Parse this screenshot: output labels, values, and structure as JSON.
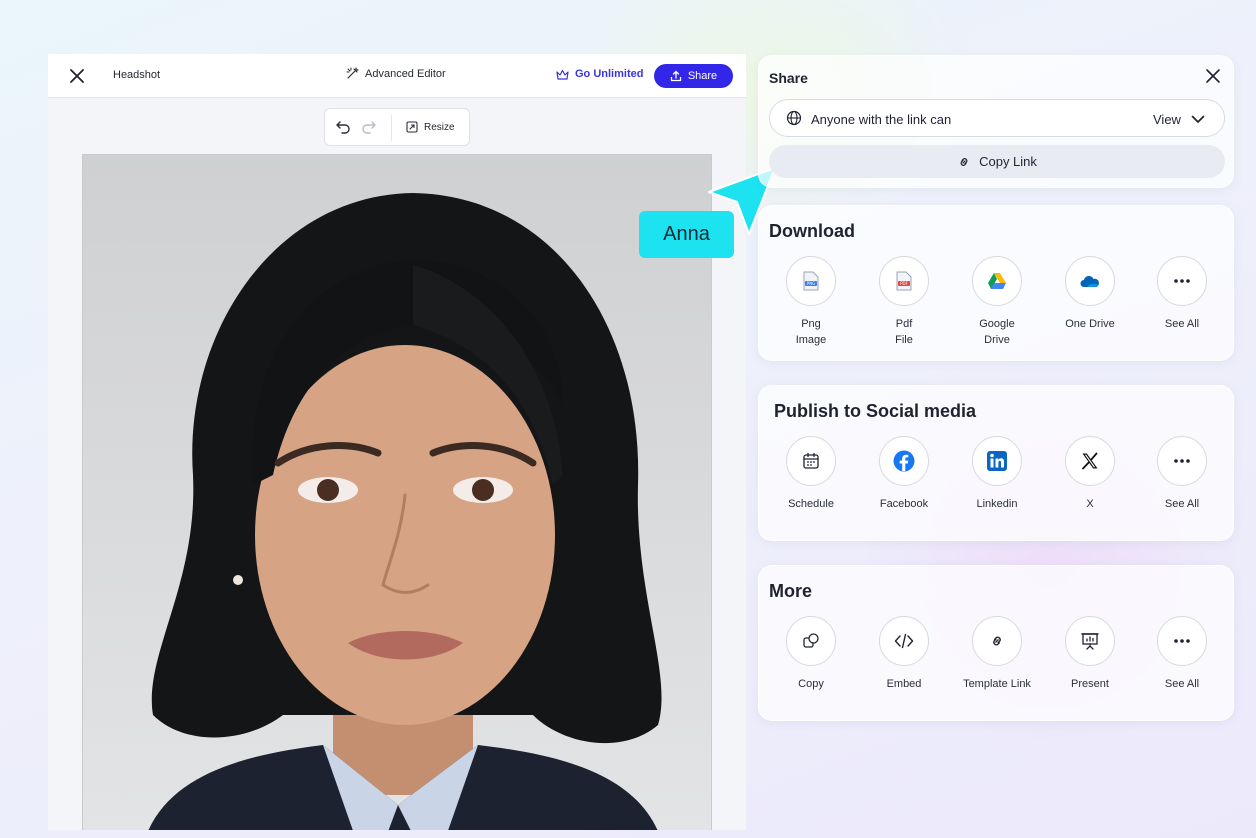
{
  "editor": {
    "title": "Headshot",
    "advanced_editor": "Advanced Editor",
    "go_unlimited": "Go Unlimited",
    "share": "Share",
    "resize": "Resize"
  },
  "cursor": {
    "label": "Anna",
    "color": "#1de3f0"
  },
  "share_panel": {
    "title": "Share",
    "access_text": "Anyone with the link can",
    "access_value": "View",
    "copy_link": "Copy Link"
  },
  "download": {
    "title": "Download",
    "items": [
      {
        "label": "Png\nImage",
        "icon": "png-file-icon"
      },
      {
        "label": "Pdf\nFile",
        "icon": "pdf-file-icon"
      },
      {
        "label": "Google\nDrive",
        "icon": "google-drive-icon"
      },
      {
        "label": "One Drive",
        "icon": "onedrive-icon"
      },
      {
        "label": "See All",
        "icon": "more-dots-icon"
      }
    ]
  },
  "social": {
    "title": "Publish to Social media",
    "items": [
      {
        "label": "Schedule",
        "icon": "calendar-icon"
      },
      {
        "label": "Facebook",
        "icon": "facebook-icon"
      },
      {
        "label": "Linkedin",
        "icon": "linkedin-icon"
      },
      {
        "label": "X",
        "icon": "x-icon"
      },
      {
        "label": "See All",
        "icon": "more-dots-icon"
      }
    ]
  },
  "more": {
    "title": "More",
    "items": [
      {
        "label": "Copy",
        "icon": "copy-icon"
      },
      {
        "label": "Embed",
        "icon": "code-icon"
      },
      {
        "label": "Template Link",
        "icon": "link-icon"
      },
      {
        "label": "Present",
        "icon": "presentation-icon"
      },
      {
        "label": "See All",
        "icon": "more-dots-icon"
      }
    ]
  },
  "colors": {
    "accent": "#3226e8",
    "facebook": "#1877f2",
    "linkedin": "#0a66c2"
  }
}
